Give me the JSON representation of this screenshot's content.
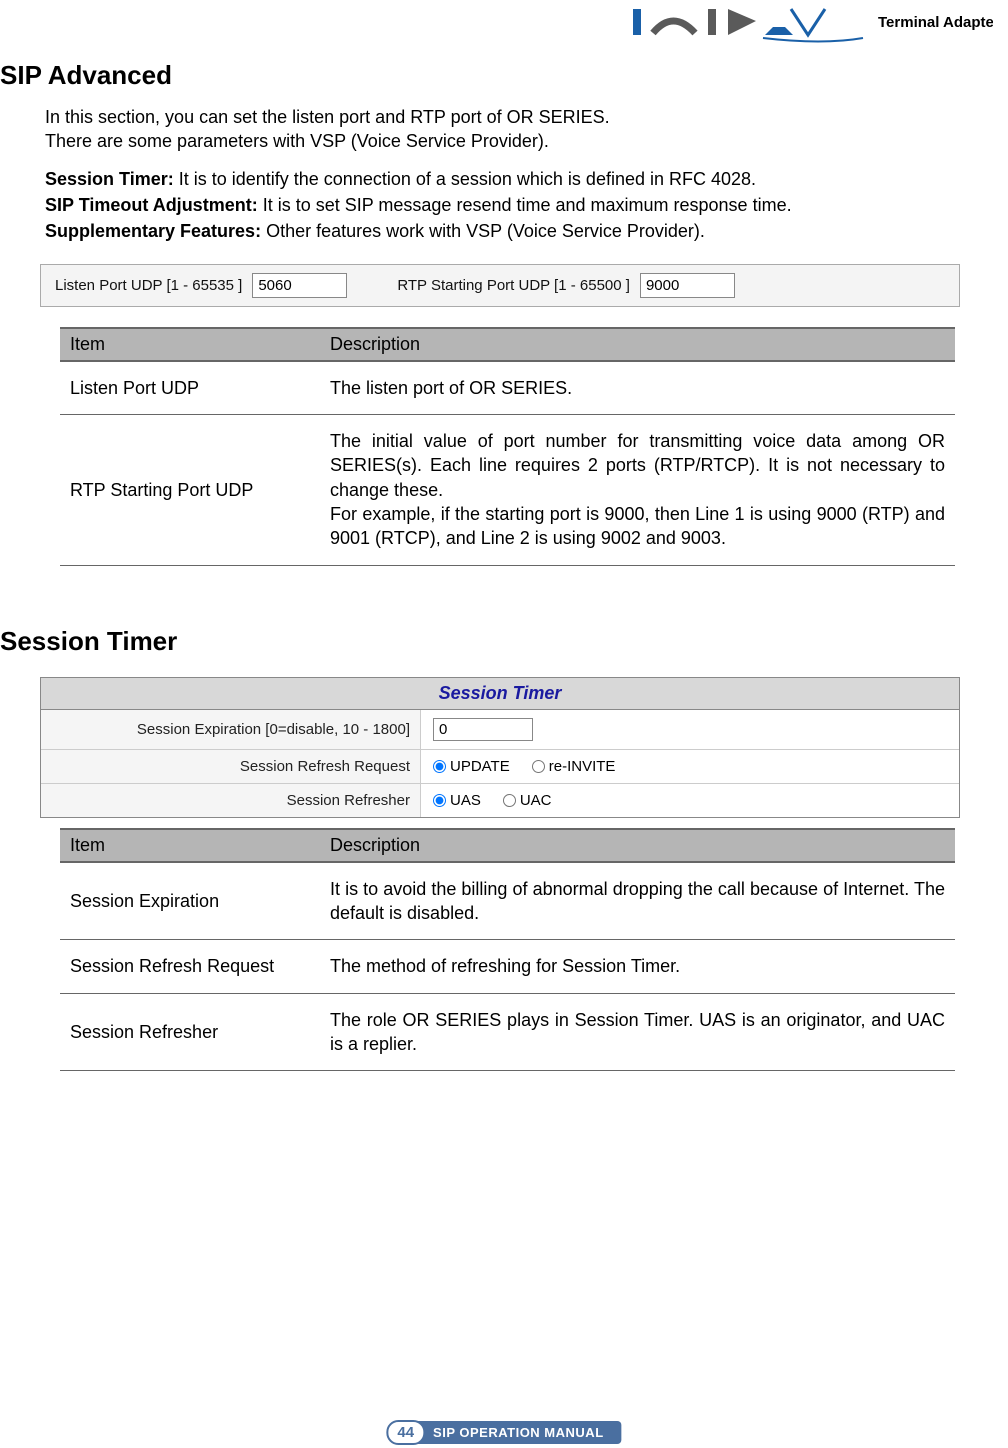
{
  "header": {
    "logo_text": "Terminal Adapter"
  },
  "h1": "SIP Advanced",
  "intro1": "In this section, you can set the listen port and RTP port of OR SERIES.",
  "intro2": "There are some parameters with VSP (Voice Service Provider).",
  "defs": {
    "st_label": "Session Timer:",
    "st_text": " It is to identify the connection of a session which is defined in RFC 4028.",
    "sto_label": "SIP Timeout Adjustment:",
    "sto_text": " It is to set SIP message resend time and maximum response time.",
    "sf_label": "Supplementary Features:",
    "sf_text": " Other features work with VSP (Voice Service Provider)."
  },
  "form1": {
    "listen_label": "Listen Port UDP [1 - 65535 ]",
    "listen_value": "5060",
    "rtp_label": "RTP Starting Port UDP [1 - 65500 ]",
    "rtp_value": "9000"
  },
  "table1": {
    "h1": "Item",
    "h2": "Description",
    "rows": [
      {
        "item": "Listen Port UDP",
        "desc": "The listen port of OR SERIES."
      },
      {
        "item": "RTP Starting Port UDP",
        "desc": "The initial value of port number for transmitting voice data among OR SERIES(s). Each line requires 2 ports (RTP/RTCP). It is not necessary to change these.\nFor example, if the starting port is 9000, then Line 1 is using 9000 (RTP) and 9001 (RTCP), and Line 2 is using 9002 and 9003."
      }
    ]
  },
  "h2": "Session Timer",
  "sessionBox": {
    "title": "Session Timer",
    "exp_label": "Session Expiration [0=disable, 10 - 1800]",
    "exp_value": "0",
    "req_label": "Session Refresh Request",
    "req_opt1": "UPDATE",
    "req_opt2": "re-INVITE",
    "refr_label": "Session Refresher",
    "refr_opt1": "UAS",
    "refr_opt2": "UAC"
  },
  "table2": {
    "h1": "Item",
    "h2": "Description",
    "rows": [
      {
        "item": "Session Expiration",
        "desc": "It is to avoid the billing of abnormal dropping the call because of Internet. The default is disabled."
      },
      {
        "item": "Session Refresh Request",
        "desc": "The method of refreshing for Session Timer."
      },
      {
        "item": "Session Refresher",
        "desc": "The role OR SERIES plays in Session Timer. UAS is an originator, and UAC is a replier."
      }
    ]
  },
  "footer": {
    "page": "44",
    "manual": "SIP OPERATION MANUAL"
  }
}
